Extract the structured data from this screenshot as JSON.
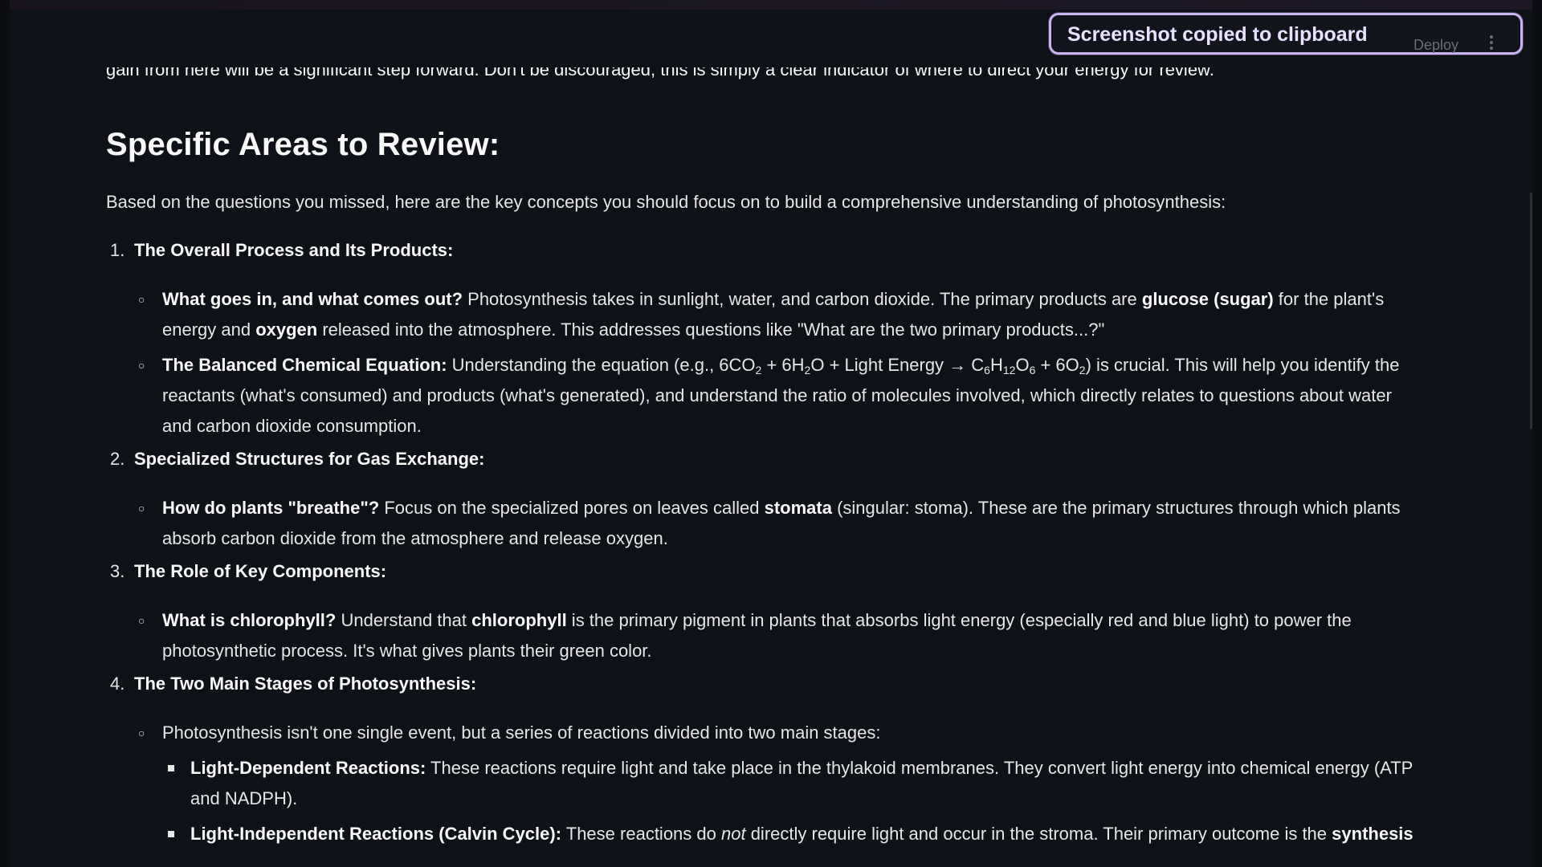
{
  "toast": {
    "message": "Screenshot copied to clipboard"
  },
  "header": {
    "deploy_label": "Deploy",
    "menu_icon": "vertical-ellipsis-icon"
  },
  "content": {
    "cut_off_line": "gain from here will be a significant step forward. Don't be discouraged, this is simply a clear indicator of where to direct your energy for review.",
    "section_title": "Specific Areas to Review:",
    "intro": "Based on the questions you missed, here are the key concepts you should focus on to build a comprehensive understanding of photosynthesis:",
    "items": [
      {
        "number": "1.",
        "heading": "The Overall Process and Its Products:",
        "sub": [
          {
            "bold": "What goes in, and what comes out?",
            "text_1": " Photosynthesis takes in sunlight, water, and carbon dioxide. The primary products are ",
            "bold_2": "glucose (sugar)",
            "text_2": " for the plant's energy and ",
            "bold_3": "oxygen",
            "text_3": " released into the atmosphere. This addresses questions like \"What are the two primary products...?\""
          },
          {
            "bold": "The Balanced Chemical Equation:",
            "text_1": " Understanding the equation (e.g., 6CO",
            "sub_1": "2",
            "text_2": " + 6H",
            "sub_2": "2",
            "text_3": "O + Light Energy → C",
            "sub_3": "6",
            "text_4": "H",
            "sub_4": "12",
            "text_5": "O",
            "sub_5": "6",
            "text_6": " + 6O",
            "sub_6": "2",
            "text_7": ") is crucial. This will help you identify the reactants (what's consumed) and products (what's generated), and understand the ratio of molecules involved, which directly relates to questions about water and carbon dioxide consumption."
          }
        ]
      },
      {
        "number": "2.",
        "heading": "Specialized Structures for Gas Exchange:",
        "sub": [
          {
            "bold": "How do plants \"breathe\"?",
            "text_1": " Focus on the specialized pores on leaves called ",
            "bold_2": "stomata",
            "text_2": " (singular: stoma). These are the primary structures through which plants absorb carbon dioxide from the atmosphere and release oxygen."
          }
        ]
      },
      {
        "number": "3.",
        "heading": "The Role of Key Components:",
        "sub": [
          {
            "bold": "What is chlorophyll?",
            "text_1": " Understand that ",
            "bold_2": "chlorophyll",
            "text_2": " is the primary pigment in plants that absorbs light energy (especially red and blue light) to power the photosynthetic process. It's what gives plants their green color."
          }
        ]
      },
      {
        "number": "4.",
        "heading": "The Two Main Stages of Photosynthesis:",
        "sub": [
          {
            "text_1": "Photosynthesis isn't one single event, but a series of reactions divided into two main stages:",
            "subsub": [
              {
                "bold": "Light-Dependent Reactions:",
                "text_1": " These reactions require light and take place in the thylakoid membranes. They convert light energy into chemical energy (ATP and NADPH)."
              },
              {
                "bold": "Light-Independent Reactions (Calvin Cycle):",
                "text_1": " These reactions do ",
                "italic": "not",
                "text_2": " directly require light and occur in the stroma. Their primary outcome is the ",
                "bold_2": "synthesis"
              }
            ]
          }
        ]
      }
    ]
  },
  "colors": {
    "background": "#0e1117",
    "text": "#fafafa",
    "toast_border": "#c9b3f5"
  }
}
